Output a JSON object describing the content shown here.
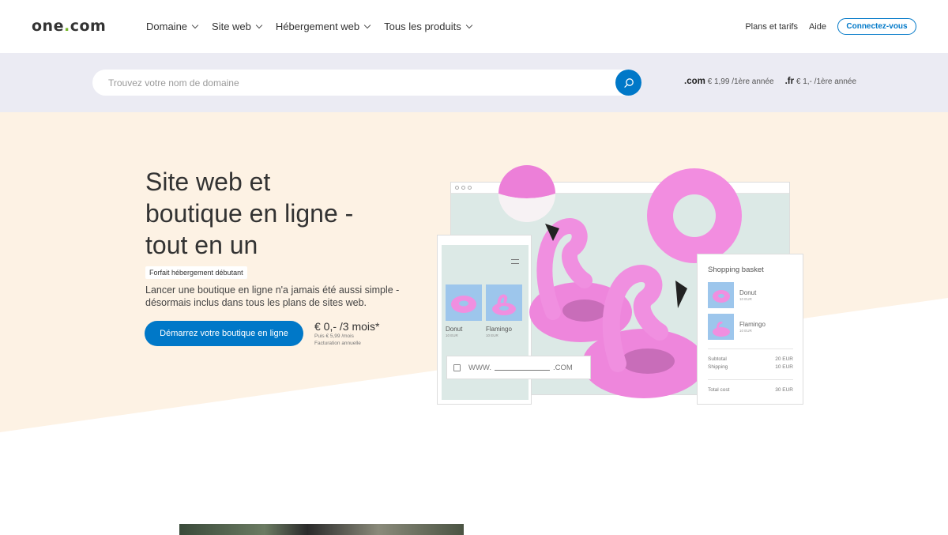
{
  "header": {
    "logo_part1": "one",
    "logo_dot": ".",
    "logo_part2": "com",
    "nav": [
      {
        "label": "Domaine"
      },
      {
        "label": "Site web"
      },
      {
        "label": "Hébergement web"
      },
      {
        "label": "Tous les produits"
      }
    ],
    "plans_label": "Plans et tarifs",
    "help_label": "Aide",
    "login_label": "Connectez-vous"
  },
  "search": {
    "placeholder": "Trouvez votre nom de domaine",
    "value": ""
  },
  "domain_prices": [
    {
      "tld": ".com",
      "price": "€ 1,99 /1ère année"
    },
    {
      "tld": ".fr",
      "price": "€ 1,- /1ère année"
    }
  ],
  "hero": {
    "title_line1": "Site web et",
    "title_line2": "boutique en ligne -",
    "title_line3": "tout en un",
    "badge": "Forfait hébergement débutant",
    "desc": "Lancer une boutique en ligne n'a jamais été aussi simple - désormais inclus dans tous les plans de sites web.",
    "cta": "Démarrez votre boutique en ligne",
    "price": "€ 0,- /3 mois*",
    "price_note1": "Puis € 5,99 /mois",
    "price_note2": "Facturation annuelle"
  },
  "illustration": {
    "product1_name": "Donut",
    "product1_price": "10 EUR",
    "product2_name": "Flamingo",
    "product2_price": "10 EUR",
    "url_prefix": "WWW.",
    "url_suffix": ".COM",
    "basket_title": "Shopping basket",
    "basket_item1": "Donut",
    "basket_item1_price": "10 EUR",
    "basket_item2": "Flamingo",
    "basket_item2_price": "10 EUR",
    "subtotal_label": "Subtotal",
    "subtotal_value": "20 EUR",
    "shipping_label": "Shipping",
    "shipping_value": "10 EUR",
    "total_label": "Total cost",
    "total_value": "30 EUR"
  },
  "colors": {
    "brand_blue": "#0078c8",
    "logo_dot_green": "#76b82a",
    "hero_bg": "#fdf2e4",
    "search_band": "#ebebf3",
    "float_pink": "#f08fe0"
  }
}
